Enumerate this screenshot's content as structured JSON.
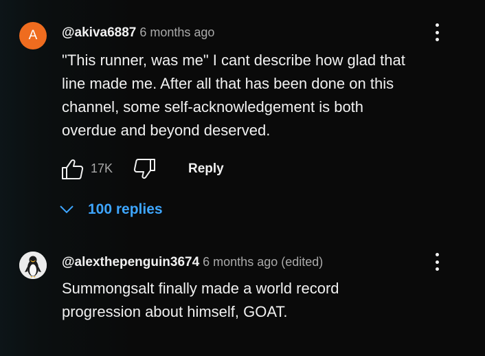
{
  "comments": [
    {
      "avatar_letter": "A",
      "avatar_color": "#ef6c1f",
      "author": "@akiva6887",
      "time": "6 months ago",
      "text_lines": [
        "\"This runner, was me\" I cant describe how glad that",
        "line made me. After all that has been done on this",
        "channel, some self-acknowledgement is both",
        "overdue and beyond deserved."
      ],
      "like_icon": "thumbs-up-icon",
      "like_count": "17K",
      "dislike_icon": "thumbs-down-icon",
      "reply_label": "Reply",
      "replies_icon": "chevron-down-icon",
      "replies_label": "100 replies"
    },
    {
      "avatar_icon": "penguin-avatar",
      "author": "@alexthepenguin3674",
      "time": "6 months ago (edited)",
      "text_lines": [
        "Summongsalt finally made a world record",
        "progression about himself, GOAT."
      ]
    }
  ],
  "colors": {
    "background": "#0a0a0a",
    "primary_text": "#f1f1f1",
    "secondary_text": "#aaaaaa",
    "link_blue": "#3ea6ff"
  }
}
